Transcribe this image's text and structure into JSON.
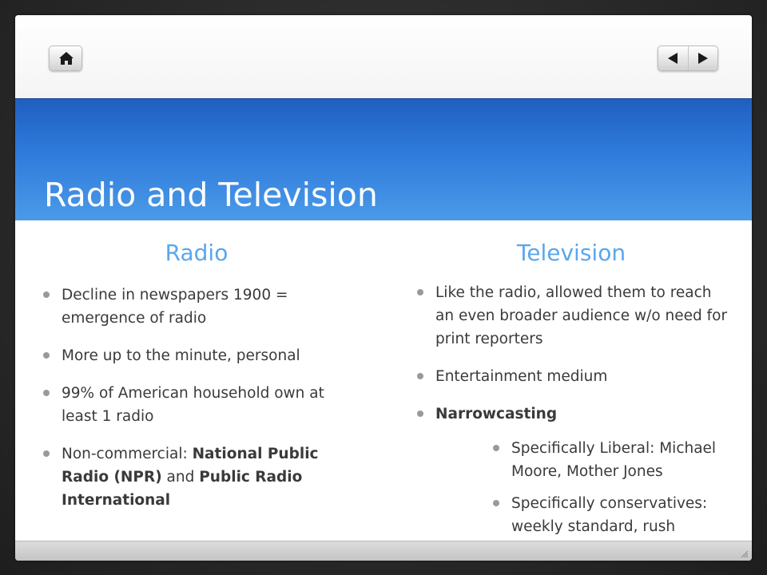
{
  "slide": {
    "title": "Radio and Television"
  },
  "nav": {
    "home_icon": "home-icon",
    "prev_icon": "arrow-left-icon",
    "next_icon": "arrow-right-icon"
  },
  "left_column": {
    "heading": "Radio",
    "items": [
      {
        "text": "Decline in newspapers 1900 = emergence of radio"
      },
      {
        "text": "More up to the minute, personal"
      },
      {
        "text": "99% of American household own at least 1 radio"
      },
      {
        "prefix": "Non-commercial: ",
        "bold1": "National Public Radio (NPR)",
        "mid": " and ",
        "bold2": "Public Radio International"
      }
    ]
  },
  "right_column": {
    "heading": "Television",
    "items": [
      {
        "text": "Like the radio, allowed them to reach an even broader audience w/o need for print reporters"
      },
      {
        "text": "Entertainment medium"
      },
      {
        "bold": "Narrowcasting"
      }
    ],
    "sub_items": [
      {
        "text": "Specifically Liberal: Michael Moore, Mother Jones"
      },
      {
        "text": "Specifically conservatives: weekly standard, rush Limbaugh"
      }
    ]
  },
  "colors": {
    "title_band": "#2f7bdc",
    "heading_text": "#5aa7ec",
    "bullet": "#999999"
  }
}
